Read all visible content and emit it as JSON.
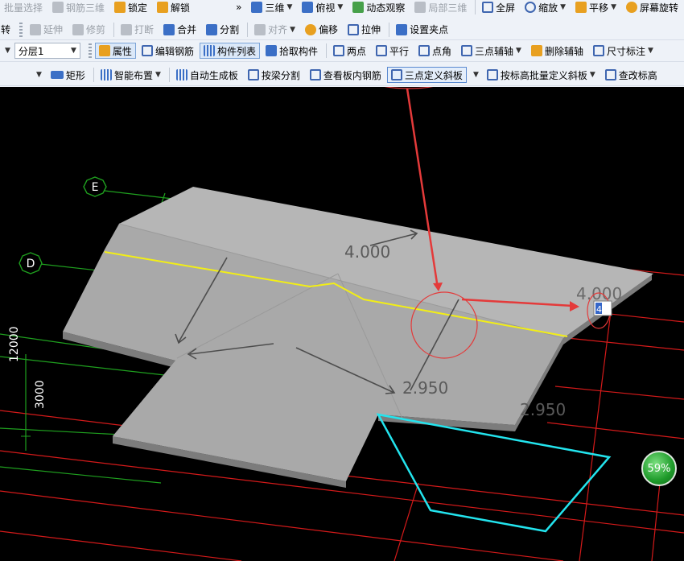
{
  "toolbar": {
    "row1": {
      "batch_select": "批量选择",
      "rebar_3d": "钢筋三维",
      "lock": "锁定",
      "unlock": "解锁",
      "more": "»",
      "view_3d": "三维",
      "top_view": "俯视",
      "dynamic_observe": "动态观察",
      "local_3d": "局部三维",
      "full_screen": "全屏",
      "zoom": "缩放",
      "pan": "平移",
      "screen_rotate": "屏幕旋转"
    },
    "row2": {
      "rotate": "转",
      "extend": "延伸",
      "trim": "修剪",
      "break": "打断",
      "merge": "合并",
      "split": "分割",
      "align": "对齐",
      "offset": "偏移",
      "stretch": "拉伸",
      "set_grip": "设置夹点"
    },
    "row3": {
      "layer_value": "分层1",
      "properties": "属性",
      "edit_rebar": "编辑钢筋",
      "component_list": "构件列表",
      "pick_component": "拾取构件",
      "two_points": "两点",
      "parallel": "平行",
      "point_angle": "点角",
      "three_point_axis": "三点辅轴",
      "delete_axis": "删除辅轴",
      "dimension": "尺寸标注"
    },
    "row4": {
      "rectangle": "矩形",
      "smart_layout": "智能布置",
      "auto_slab": "自动生成板",
      "split_by_beam": "按梁分割",
      "view_slab_rebar": "查看板内钢筋",
      "three_point_slope": "三点定义斜板",
      "batch_slope_by_elevation": "按标高批量定义斜板",
      "check_elevation": "查改标高"
    }
  },
  "viewport": {
    "axis_labels": {
      "e": "E",
      "d": "D"
    },
    "dimensions": {
      "vertical_12000": "12000",
      "vertical_3000": "3000"
    },
    "elevations": {
      "top_left": "4.000",
      "top_right": "4.000",
      "mid": "2.950",
      "bottom_right": "2.950"
    },
    "input_value": "4",
    "progress_badge": "59%",
    "colors": {
      "grid_red": "#d41a1a",
      "grid_green": "#1fa01f",
      "slab_top": "#a9a9a9",
      "slab_top_far": "#b6b6b6",
      "slab_edge": "#7c7c7c",
      "yellow_line": "#f2ee16",
      "cyan_outline": "#23e4ee",
      "annotation_red": "#e43a3a"
    }
  }
}
